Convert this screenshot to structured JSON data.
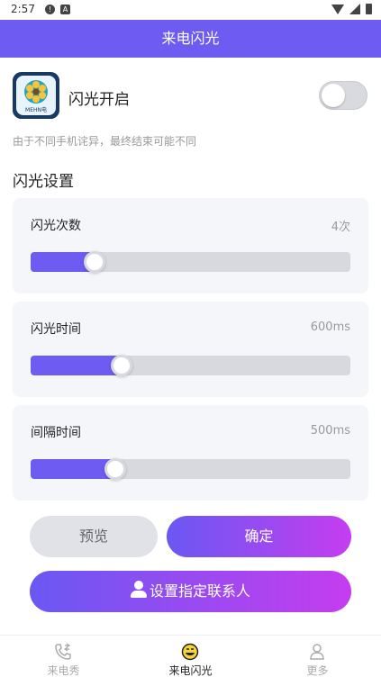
{
  "status_bar": {
    "time": "2:57"
  },
  "app_bar": {
    "title": "来电闪光"
  },
  "flash_toggle": {
    "label": "闪光开启",
    "on": false,
    "icon_text": "MEHN电"
  },
  "hint": "由于不同手机诧异，最终结束可能不同",
  "section_title": "闪光设置",
  "settings": [
    {
      "label": "闪光次数",
      "value": "4次",
      "fraction": 0.2
    },
    {
      "label": "闪光时间",
      "value": "600ms",
      "fraction": 0.285
    },
    {
      "label": "间隔时间",
      "value": "500ms",
      "fraction": 0.265
    }
  ],
  "buttons": {
    "preview": "预览",
    "confirm": "确定",
    "contact": "设置指定联系人"
  },
  "nav": [
    {
      "label": "来电秀",
      "icon": "phone-icon",
      "active": false
    },
    {
      "label": "来电闪光",
      "icon": "smiley-icon",
      "active": true
    },
    {
      "label": "更多",
      "icon": "person-icon",
      "active": false
    }
  ],
  "colors": {
    "accent": "#6e5bf2",
    "gradient_end": "#c53df0",
    "track": "#d8d9de"
  }
}
